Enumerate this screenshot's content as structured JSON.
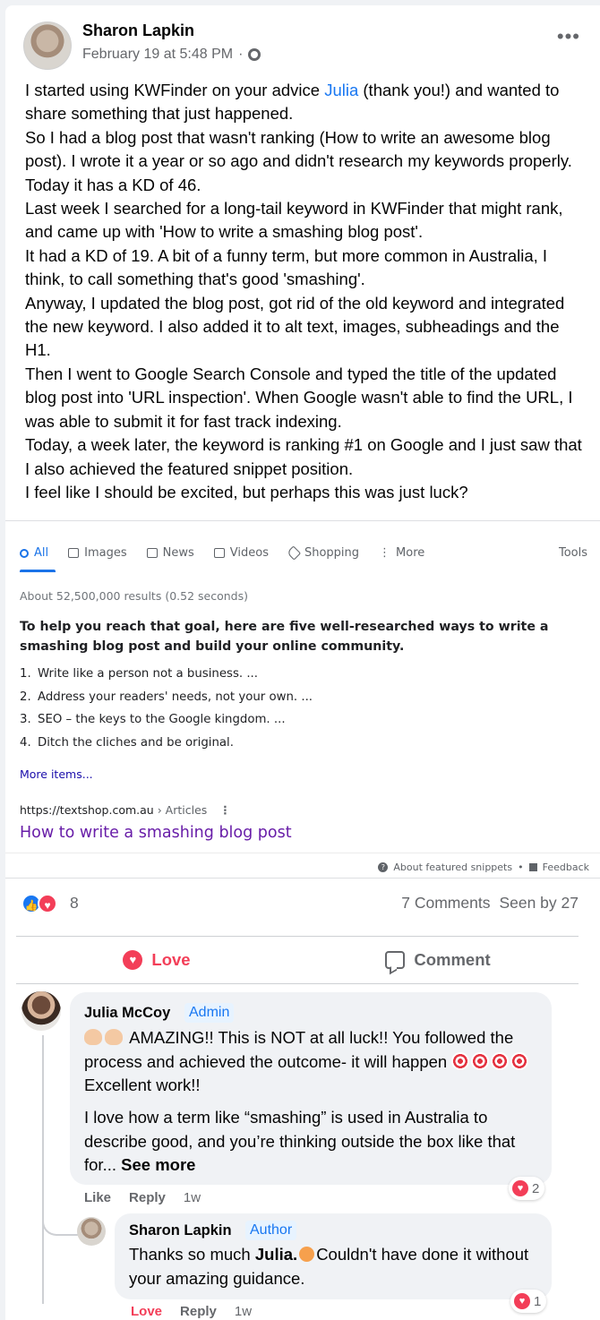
{
  "post": {
    "author": "Sharon Lapkin",
    "timestamp": "February 19 at 5:48 PM",
    "separator": "·",
    "more": "•••",
    "text_before_mention": "I started using KWFinder on your advice ",
    "mention": "Julia",
    "text_after_mention": " (thank you!) and wanted to share something that just happened.",
    "paragraphs": [
      "So I had a blog post that wasn't ranking (How to write an awesome blog post). I wrote it a year or so ago and didn't research my keywords properly. Today it has a KD of 46.",
      "Last week I searched for a long-tail keyword in KWFinder that might rank, and came up with 'How to write a smashing blog post'.",
      "It had a KD of 19. A bit of a funny term, but more common in Australia, I think, to call something that's good 'smashing'.",
      "Anyway, I updated the blog post, got rid of the old keyword and integrated the new keyword. I also added it to alt text, images, subheadings and the H1.",
      "Then I went to Google Search Console and typed the title of the updated blog post into 'URL inspection'. When Google wasn't able to find the URL, I was able to submit it for fast track indexing.",
      "Today, a week later, the keyword is ranking #1 on Google and I just saw that I also achieved the featured snippet position.",
      "I feel like I should be excited, but perhaps this was just luck?"
    ]
  },
  "serp": {
    "tabs": [
      "All",
      "Images",
      "News",
      "Videos",
      "Shopping",
      "More"
    ],
    "tools": "Tools",
    "results_count": "About 52,500,000 results (0.52 seconds)",
    "snippet_title": "To help you reach that goal, here are five well-researched ways to write a smashing blog post and build your online community.",
    "items": [
      {
        "num": "1.",
        "text": "Write like a person not a business. ..."
      },
      {
        "num": "2.",
        "text": "Address your readers' needs, not your own. ..."
      },
      {
        "num": "3.",
        "text": "SEO – the keys to the Google kingdom. ..."
      },
      {
        "num": "4.",
        "text": "Ditch the cliches and be original."
      }
    ],
    "more_items": "More items...",
    "url": "https://textshop.com.au",
    "url_path": " › Articles",
    "kebab": "⋮",
    "result_title": "How to write a smashing blog post",
    "about_snippets": "About featured snippets",
    "dot": "•",
    "feedback": "Feedback"
  },
  "reactions": {
    "count": "8",
    "comments": "7 Comments",
    "seen": "Seen by 27",
    "like_glyph": "👍",
    "love_glyph": "♥"
  },
  "actions": {
    "love": "Love",
    "comment": "Comment"
  },
  "comments": [
    {
      "author": "Julia McCoy",
      "badge": "Admin",
      "line1": "AMAZING!! This is NOT at all luck!! You followed the process and achieved the outcome- it will happen",
      "line1_end": "Excellent work!!",
      "para2": "I love how a term like “smashing” is used in Australia to describe good, and you’re thinking outside the box like that for... ",
      "see_more": "See more",
      "like": "Like",
      "reply": "Reply",
      "time": "1w",
      "reaction_count": "2"
    },
    {
      "author": "Sharon Lapkin",
      "badge": "Author",
      "text_before": "Thanks so much ",
      "bold": "Julia.",
      "text_after": "Couldn't have done it without your amazing guidance.",
      "love": "Love",
      "reply": "Reply",
      "time": "1w",
      "reaction_count": "1"
    }
  ],
  "colors": {
    "facebook_blue": "#1877f2",
    "love_red": "#f33e58",
    "google_blue": "#1a73e8",
    "visited_link": "#681da8"
  }
}
